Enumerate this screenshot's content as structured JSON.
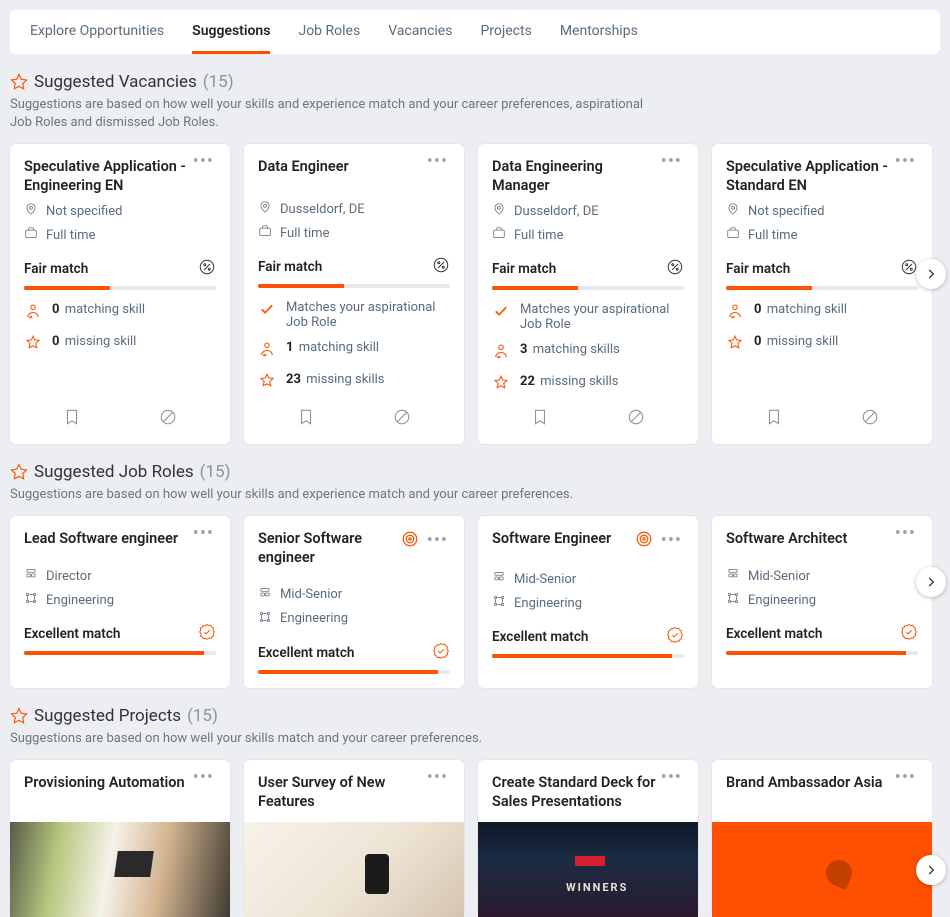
{
  "tabs": [
    {
      "label": "Explore Opportunities",
      "active": false
    },
    {
      "label": "Suggestions",
      "active": true
    },
    {
      "label": "Job Roles",
      "active": false
    },
    {
      "label": "Vacancies",
      "active": false
    },
    {
      "label": "Projects",
      "active": false
    },
    {
      "label": "Mentorships",
      "active": false
    }
  ],
  "vacancies": {
    "title": "Suggested Vacancies",
    "count": "(15)",
    "subtitle": "Suggestions are based on how well your skills and experience match and your career preferences, aspirational Job Roles and dismissed Job Roles.",
    "items": [
      {
        "title": "Speculative Application - Engineering EN",
        "location": "Not specified",
        "type": "Full time",
        "match": "Fair match",
        "progress": 45,
        "aspirational": false,
        "matching": "0",
        "matching_label": "matching skill",
        "missing": "0",
        "missing_label": "missing skill"
      },
      {
        "title": "Data Engineer",
        "location": "Dusseldorf, DE",
        "type": "Full time",
        "match": "Fair match",
        "progress": 45,
        "aspirational": true,
        "aspirational_text": "Matches your aspirational Job Role",
        "matching": "1",
        "matching_label": "matching skill",
        "missing": "23",
        "missing_label": "missing skills"
      },
      {
        "title": "Data Engineering Manager",
        "location": "Dusseldorf, DE",
        "type": "Full time",
        "match": "Fair match",
        "progress": 45,
        "aspirational": true,
        "aspirational_text": "Matches your aspirational Job Role",
        "matching": "3",
        "matching_label": "matching skills",
        "missing": "22",
        "missing_label": "missing skills"
      },
      {
        "title": "Speculative Application - Standard EN",
        "location": "Not specified",
        "type": "Full time",
        "match": "Fair match",
        "progress": 45,
        "aspirational": false,
        "matching": "0",
        "matching_label": "matching skill",
        "missing": "0",
        "missing_label": "missing skill"
      }
    ]
  },
  "roles": {
    "title": "Suggested Job Roles",
    "count": "(15)",
    "subtitle": "Suggestions are based on how well your skills and experience match and your career preferences.",
    "items": [
      {
        "title": "Lead Software engineer",
        "level": "Director",
        "dept": "Engineering",
        "match": "Excellent match",
        "target": false,
        "progress": 94
      },
      {
        "title": "Senior Software engineer",
        "level": "Mid-Senior",
        "dept": "Engineering",
        "match": "Excellent match",
        "target": true,
        "progress": 94
      },
      {
        "title": "Software Engineer",
        "level": "Mid-Senior",
        "dept": "Engineering",
        "match": "Excellent match",
        "target": true,
        "progress": 94
      },
      {
        "title": "Software Architect",
        "level": "Mid-Senior",
        "dept": "Engineering",
        "match": "Excellent match",
        "target": false,
        "progress": 94
      }
    ]
  },
  "projects": {
    "title": "Suggested Projects",
    "count": "(15)",
    "subtitle": "Suggestions are based on how well your skills match and your career preferences.",
    "items": [
      {
        "title": "Provisioning Automation"
      },
      {
        "title": "User Survey of New Features"
      },
      {
        "title": "Create Standard Deck for Sales Presentations"
      },
      {
        "title": "Brand Ambassador Asia"
      }
    ]
  }
}
